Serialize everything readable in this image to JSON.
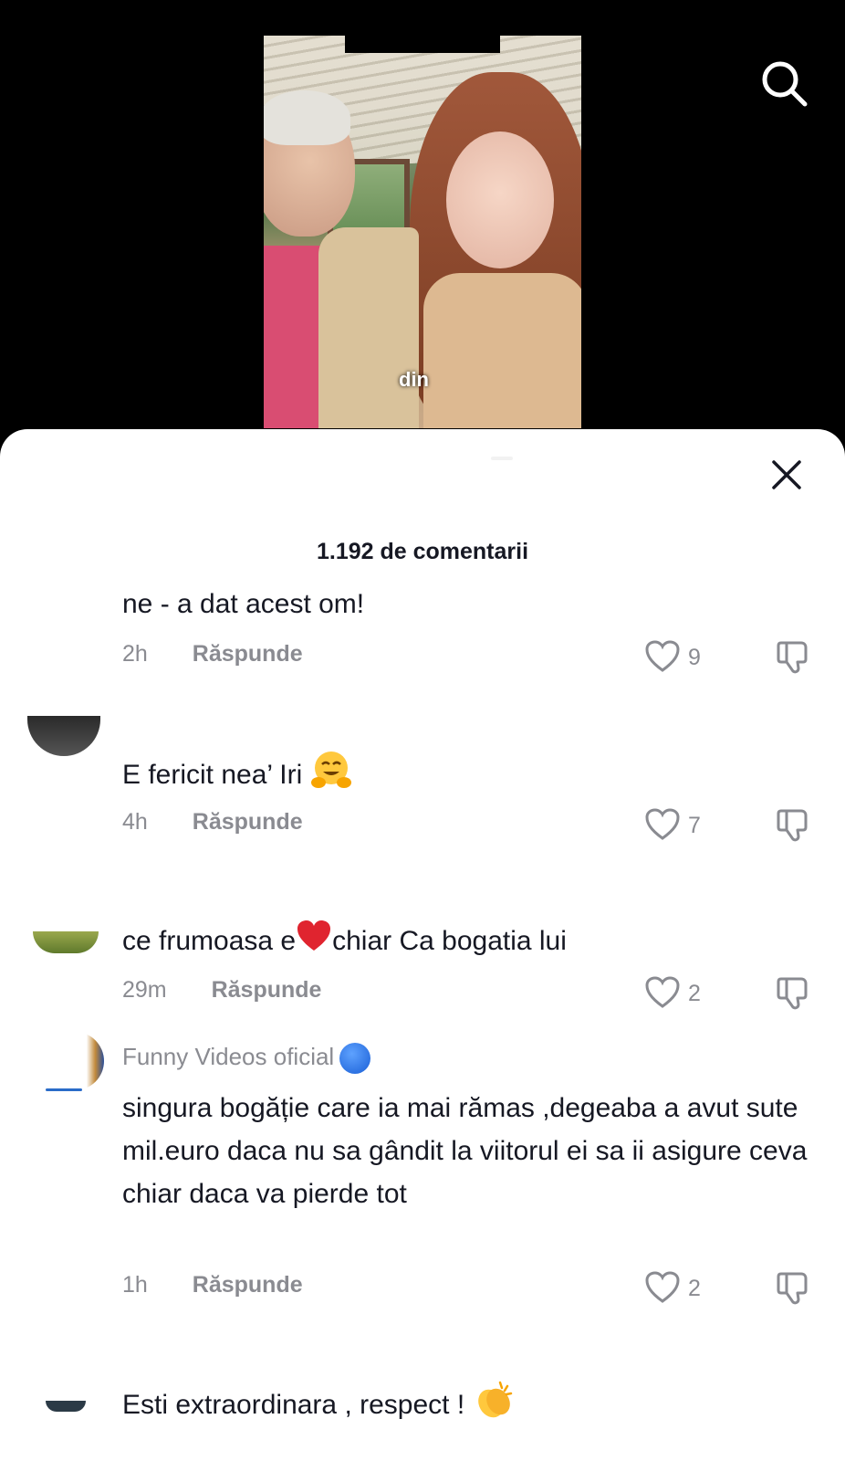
{
  "video": {
    "caption": "din"
  },
  "sheet": {
    "title": "1.192 de comentarii"
  },
  "comments": [
    {
      "text": "ne - a dat acest om!",
      "time": "2h",
      "reply": "Răspunde",
      "likes": "9"
    },
    {
      "text": "E fericit nea’ Iri",
      "emoji": "hugging-face",
      "time": "4h",
      "reply": "Răspunde",
      "likes": "7"
    },
    {
      "text_a": "ce frumoasa e",
      "text_b": "chiar Ca bogatia lui",
      "emoji": "red-heart",
      "time": "29m",
      "reply": "Răspunde",
      "likes": "2"
    },
    {
      "username": "Funny Videos oficial",
      "text": "singura bogăție care ia mai rămas ,degeaba a avut sute mil.euro daca nu sa gândit la viitorul ei sa ii asigure ceva chiar daca va pierde tot",
      "time": "1h",
      "reply": "Răspunde",
      "likes": "2"
    },
    {
      "text": "Esti extraordinara , respect !",
      "emoji": "clapping-hands"
    }
  ],
  "icons": {
    "search": "search-icon",
    "close": "close-icon",
    "like": "heart-outline-icon",
    "dislike": "thumbs-down-icon"
  },
  "colors": {
    "text_primary": "#161823",
    "text_secondary": "#8a8b91",
    "sheet_bg": "#ffffff",
    "video_bg": "#000000"
  }
}
